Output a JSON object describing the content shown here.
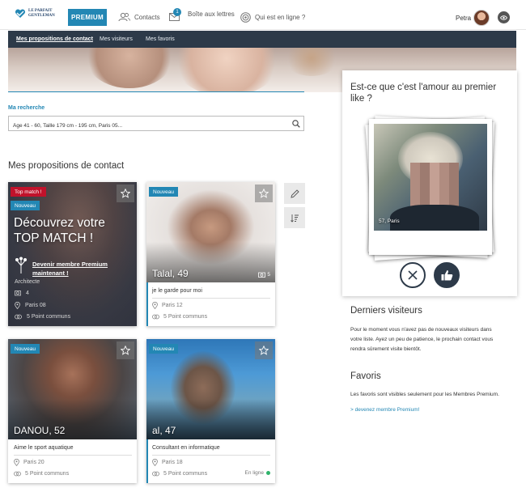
{
  "header": {
    "logo_text_line1": "LE PARFAIT",
    "logo_text_line2": "GENTLEMAN",
    "premium_label": "PREMIUM",
    "nav": [
      {
        "label": "Contacts",
        "icon": "users-icon"
      },
      {
        "label": "Boîte aux lettres",
        "icon": "envelope-icon",
        "badge": "1"
      },
      {
        "label": "Qui est en ligne ?",
        "icon": "online-radar-icon"
      }
    ],
    "user_name": "Petra"
  },
  "subnav": {
    "items": [
      "Mes propositions de contact",
      "Mes visiteurs",
      "Mes favoris"
    ],
    "active": "Mes propositions de contact"
  },
  "search": {
    "label": "Ma recherche",
    "value": "Âge 41 - 60, Taille 179 cm - 195 cm, Paris 05..."
  },
  "section_title": "Mes propositions de contact",
  "top_match_card": {
    "tag_top": "Top match !",
    "tag_new": "Nouveau",
    "title_line1": "Découvrez votre",
    "title_line2": "TOP MATCH !",
    "link_line1": "Devenir membre Premium",
    "link_line2": "maintenant !",
    "job": "Architecte",
    "photos": "4",
    "location": "Paris 08",
    "common": "5 Point communs"
  },
  "cards": [
    {
      "tag": "Nouveau",
      "name": "Talal, 49",
      "photo_count": "5",
      "desc": "je le garde pour moi",
      "location": "Paris 12",
      "common": "5 Point communs"
    },
    {
      "tag": "Nouveau",
      "name": "DANOU, 52",
      "desc": "Aime le sport aquatique",
      "location": "Paris 20",
      "common": "5 Point communs"
    },
    {
      "tag": "Nouveau",
      "name": "al, 47",
      "desc": "Consultant en informatique",
      "location": "Paris 18",
      "common": "5 Point communs",
      "status": "En ligne"
    }
  ],
  "love_panel": {
    "title": "Est-ce que c'est l'amour au premier like ?",
    "photo_label": "57, Paris"
  },
  "visitors": {
    "title": "Derniers visiteurs",
    "text_line1": "Pour le moment vous n'avez pas de nouveaux visiteurs dans",
    "text_line2": "votre liste. Ayez un peu de patience, le prochain contact vous",
    "text_line3": "rendra sûrement visite bientôt."
  },
  "favorites": {
    "title": "Favoris",
    "text": "Les favoris sont visibles seulement pour les Membres Premium.",
    "link": "> devenez membre Premium!"
  },
  "colors": {
    "accent": "#2387b4",
    "navy": "#2d3a49",
    "alert": "#c1122b",
    "online": "#2fb36b"
  }
}
